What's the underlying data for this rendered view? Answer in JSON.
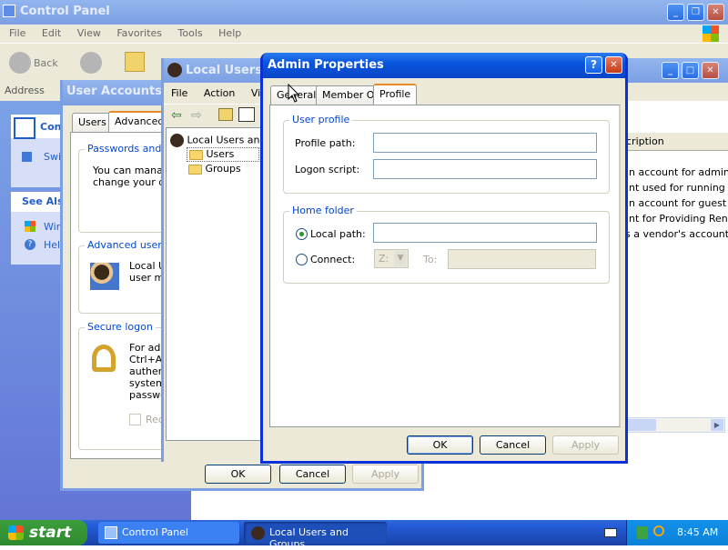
{
  "colors": {
    "xp_blue": "#0a46c8",
    "dialog_bg": "#ece9d8",
    "desktop_green": "#3a8d2a"
  },
  "control_panel": {
    "title": "Control Panel",
    "menu": [
      "File",
      "Edit",
      "View",
      "Favorites",
      "Tools",
      "Help"
    ],
    "back_label": "Back",
    "address_label": "Address",
    "side_tasks_title": "Contr",
    "side_switch": "Swi",
    "see_also_title": "See Als",
    "see_also_items": [
      "Win",
      "Help"
    ],
    "column_header": "cription",
    "descriptions": [
      "-in account for adminis",
      "unt used for running",
      "-in account for guest a",
      "unt for Providing Ren",
      "is a vendor's account"
    ]
  },
  "user_accounts": {
    "title": "User Accounts",
    "tabs": [
      "Users",
      "Advanced"
    ],
    "passwords_group": "Passwords and",
    "passwords_text_1": "You can manage",
    "passwords_text_2": "change your def",
    "advanced_group": "Advanced user m",
    "advanced_text_1": "Local Us",
    "advanced_text_2": "user ma",
    "secure_group": "Secure logon",
    "secure_lines": [
      "For add",
      "Ctrl+Alt",
      "authent",
      "system",
      "passwo"
    ],
    "require_label": "Requ",
    "ok": "OK",
    "cancel": "Cancel",
    "apply": "Apply"
  },
  "lusrmgr": {
    "title": "Local Users a",
    "menu": [
      "File",
      "Action",
      "View"
    ],
    "tree_root": "Local Users and",
    "tree_items": [
      "Users",
      "Groups"
    ]
  },
  "dialog": {
    "title": "Admin Properties",
    "help_btn": "?",
    "tabs": [
      "General",
      "Member Of",
      "Profile"
    ],
    "user_profile_group": "User profile",
    "profile_path_label": "Profile path:",
    "logon_script_label": "Logon script:",
    "home_folder_group": "Home folder",
    "local_path_label": "Local path:",
    "connect_label": "Connect:",
    "drive_value": "Z:",
    "to_label": "To:",
    "ok": "OK",
    "cancel": "Cancel",
    "apply": "Apply"
  },
  "taskbar": {
    "start": "start",
    "items": [
      "Control Panel",
      "Local Users and Groups"
    ],
    "clock": "8:45 AM"
  }
}
